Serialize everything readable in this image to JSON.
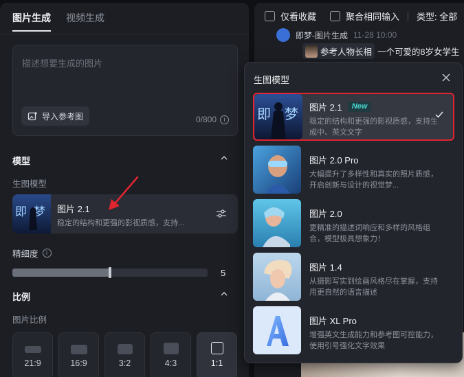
{
  "left_panel": {
    "tabs": [
      {
        "label": "图片生成",
        "active": true
      },
      {
        "label": "视频生成",
        "active": false
      }
    ],
    "prompt": {
      "placeholder": "描述想要生成的图片",
      "ref_button": "导入参考图",
      "counter": "0/800"
    },
    "model_section": {
      "title": "模型",
      "sub_label": "生图模型",
      "selected_model": {
        "name": "图片 2.1",
        "desc": "稳定的结构和更强的影视质感，支持..."
      }
    },
    "fineness": {
      "label": "精细度",
      "value": "5",
      "fill_percent": 50
    },
    "ratio_section": {
      "title": "比例",
      "sub_label": "图片比例",
      "options": [
        {
          "label": "21:9",
          "active": false
        },
        {
          "label": "16:9",
          "active": false
        },
        {
          "label": "3:2",
          "active": false
        },
        {
          "label": "4:3",
          "active": false
        },
        {
          "label": "1:1",
          "active": true
        }
      ]
    }
  },
  "right_panel": {
    "filters": {
      "only_favorites": "仅看收藏",
      "merge_inputs": "聚合相同输入",
      "type_label": "类型: 全部"
    },
    "feed": {
      "source": "即梦-图片生成",
      "date": "11-28  10:00",
      "ref_chip": "参考人物长相",
      "prompt": "一个可爱的8岁女学生"
    }
  },
  "popup": {
    "title": "生图模型",
    "options": [
      {
        "name": "图片 2.1",
        "badge": "New",
        "desc": "稳定的结构和更强的影视质感，支持生成中、英文文字",
        "selected": true,
        "thumb": "model-2-1-thumb"
      },
      {
        "name": "图片 2.0 Pro",
        "desc": "大幅提升了多样性和真实的照片质感，开启创新与设计的视觉梦...",
        "selected": false,
        "thumb": "model-2-0-pro-thumb"
      },
      {
        "name": "图片 2.0",
        "desc": "更精准的描述词响应和多样的风格组合，模型极具想象力！",
        "selected": false,
        "thumb": "model-2-0-thumb"
      },
      {
        "name": "图片 1.4",
        "desc": "从摄影写实到绘画风格尽在掌握，支持用更自然的语言描述",
        "selected": false,
        "thumb": "model-1-4-thumb"
      },
      {
        "name": "图片 XL Pro",
        "desc": "增强英文生成能力和参考图可控能力，使用引号强化文字效果",
        "selected": false,
        "thumb": "model-xl-pro-thumb"
      }
    ]
  },
  "colors": {
    "selection_border": "#e02430",
    "new_badge": "#4ad7d0",
    "arrow": "#e02430"
  }
}
